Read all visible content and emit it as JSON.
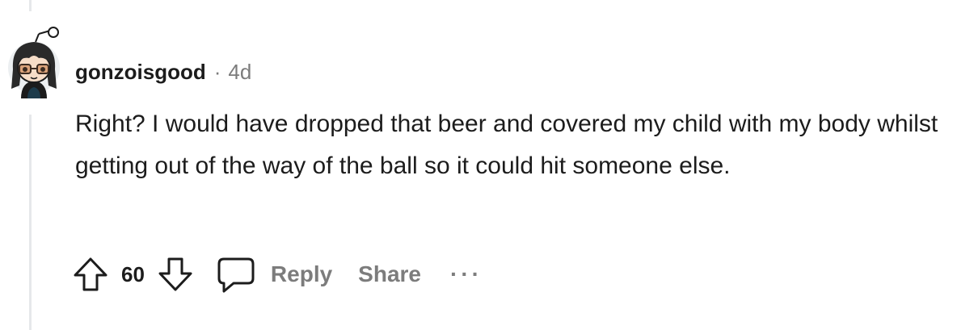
{
  "comment": {
    "username": "gonzoisgood",
    "separator": "·",
    "age": "4d",
    "body": "Right? I would have dropped that beer and covered my child with my body whilst getting out of the way of the ball so it could hit someone else."
  },
  "actions": {
    "vote_count": "60",
    "reply_label": "Reply",
    "share_label": "Share",
    "more_label": "···"
  },
  "icons": {
    "upvote": "upvote-arrow-icon",
    "downvote": "downvote-arrow-icon",
    "reply": "speech-bubble-icon",
    "more": "ellipsis-icon"
  },
  "colors": {
    "text": "#1c1c1c",
    "muted": "#7c7c7c",
    "thread_line": "#e6e8ea"
  }
}
